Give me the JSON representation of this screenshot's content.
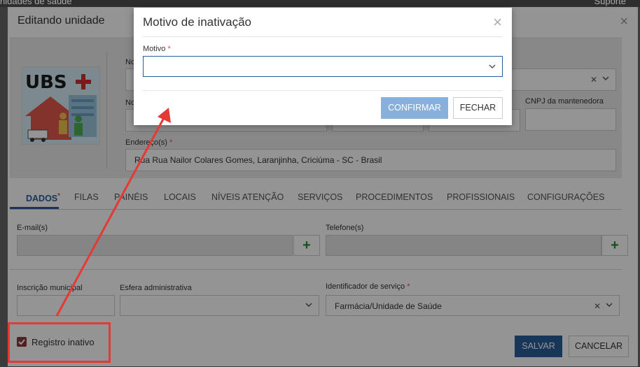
{
  "background": {
    "top_left_text": "nidades de saúde",
    "top_right_text": "Suporte"
  },
  "edit_modal": {
    "title": "Editando unidade",
    "close_symbol": "×",
    "logo_text": "UBS",
    "fields": {
      "address_label": "Endereço(s)",
      "address_value": "Rua Rua Nailor Colares Gomes, Laranjinha, Criciúma - SC - Brasil",
      "cnpj_label": "CNPJ da mantenedora",
      "no_label_1": "No",
      "no_label_2": "No",
      "email_label": "E-mail(s)",
      "phone_label": "Telefone(s)",
      "municipal_label": "Inscrição municipal",
      "sphere_label": "Esfera administrativa",
      "service_id_label": "Identificador de serviço",
      "service_id_value": "Farmácia/Unidade de Saúde"
    },
    "tabs": [
      "DADOS",
      "FILAS",
      "PAINÉIS",
      "LOCAIS",
      "NÍVEIS ATENÇÃO",
      "SERVIÇOS",
      "PROCEDIMENTOS",
      "PROFISSIONAIS",
      "CONFIGURAÇÕES"
    ],
    "required_mark": "*",
    "inactive_checkbox_label": "Registro inativo",
    "inactive_checked": true,
    "save_label": "SALVAR",
    "cancel_label": "CANCELAR"
  },
  "inactivation_modal": {
    "title": "Motivo de inativação",
    "close_symbol": "×",
    "reason_label": "Motivo",
    "reason_value": "",
    "confirm_label": "CONFIRMAR",
    "close_label": "FECHAR"
  },
  "colors": {
    "primary": "#2a5d9a",
    "confirm_disabled": "#89b0dc",
    "annotation_red": "#e53935",
    "add_green": "#2e8b3a"
  }
}
